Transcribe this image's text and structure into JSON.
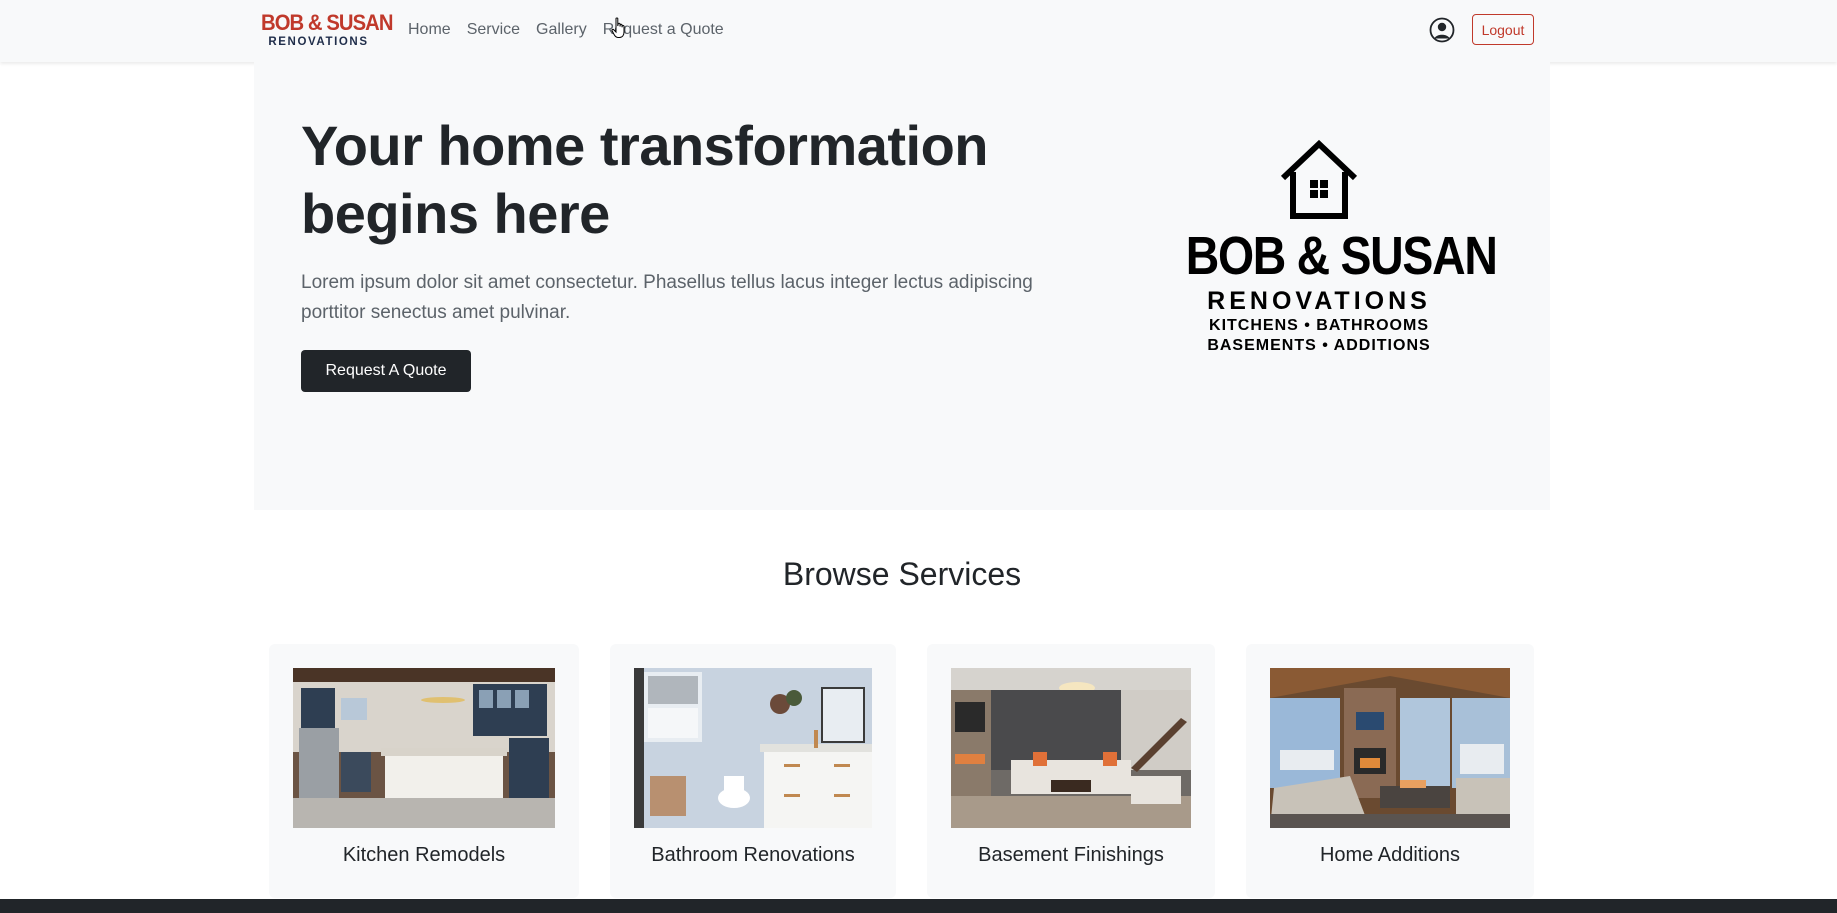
{
  "navbar": {
    "brand_top": "BOB & SUSAN",
    "brand_bottom": "RENOVATIONS",
    "links": [
      "Home",
      "Service",
      "Gallery",
      "Request a Quote"
    ],
    "logout_label": "Logout",
    "user_icon": "user-circle-icon"
  },
  "hero": {
    "title": "Your home transformation begins here",
    "lead": "Lorem ipsum dolor sit amet consectetur. Phasellus tellus lacus integer lectus adipiscing porttitor senectus amet pulvinar.",
    "button_label": "Request A Quote",
    "logo": {
      "main": "BOB & SUSAN",
      "sub": "RENOVATIONS",
      "tag_line1": "KITCHENS • BATHROOMS",
      "tag_line2": "BASEMENTS • ADDITIONS"
    }
  },
  "services": {
    "title": "Browse Services",
    "items": [
      {
        "label": "Kitchen Remodels"
      },
      {
        "label": "Bathroom Renovations"
      },
      {
        "label": "Basement Finishings"
      },
      {
        "label": "Home Additions"
      }
    ]
  },
  "colors": {
    "brand_red": "#c0392b",
    "brand_navy": "#1f2d4a",
    "dark": "#212529",
    "light_bg": "#f8f9fa"
  }
}
